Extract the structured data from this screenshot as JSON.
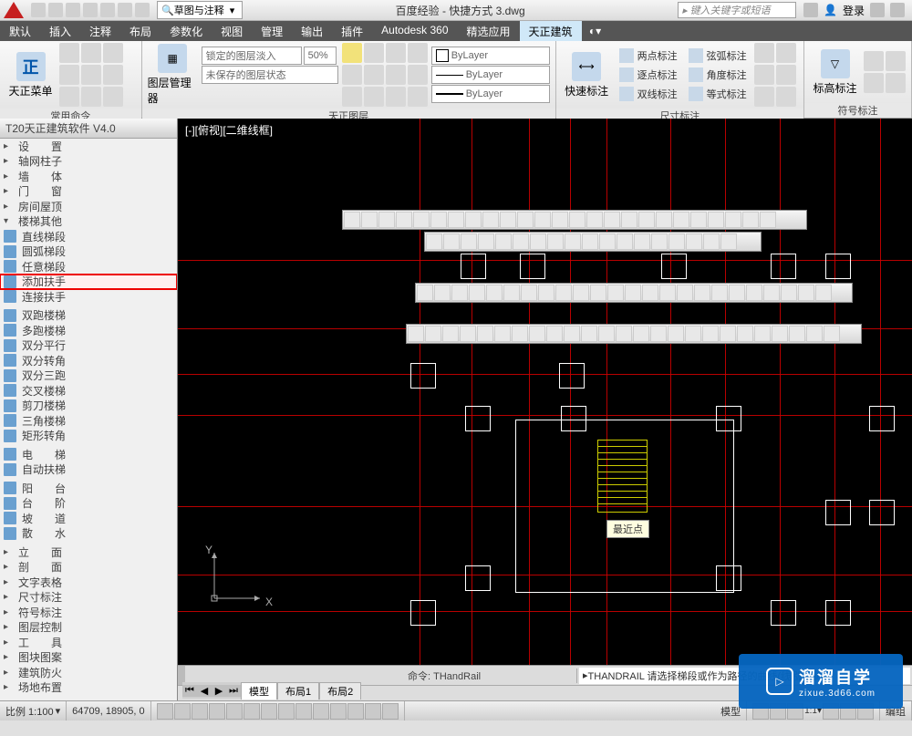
{
  "title_bar": {
    "app_title": "百度经验 - 快捷方式 3.dwg",
    "main_dropdown": "草图与注释",
    "search_placeholder": "键入关键字或短语",
    "login_label": "登录"
  },
  "menu_tabs": [
    "默认",
    "插入",
    "注释",
    "布局",
    "参数化",
    "视图",
    "管理",
    "输出",
    "插件",
    "Autodesk 360",
    "精选应用",
    "天正建筑"
  ],
  "menu_active_index": 11,
  "ribbon": {
    "groups": [
      {
        "label": "常用命令",
        "big": {
          "text": "天正菜单"
        }
      },
      {
        "label": "天正图层",
        "big": {
          "text": "图层管理器"
        },
        "combos": [
          {
            "text": "锁定的图层淡入",
            "val": "50%"
          },
          {
            "text": "未保存的图层状态"
          }
        ],
        "layer_rows": [
          {
            "text": "ByLayer"
          },
          {
            "text": "ByLayer"
          },
          {
            "text": "ByLayer"
          }
        ]
      },
      {
        "label": "尺寸标注",
        "big": {
          "text": "快速标注"
        },
        "lbls": [
          "两点标注",
          "逐点标注",
          "双线标注",
          "弦弧标注",
          "角度标注",
          "等式标注"
        ]
      },
      {
        "label": "符号标注",
        "big": {
          "text": "标高标注"
        }
      }
    ]
  },
  "left_panel": {
    "title": "T20天正建筑软件 V4.0",
    "top_items": [
      "设　　置",
      "轴网柱子",
      "墙　　体",
      "门　　窗",
      "房间屋顶",
      "楼梯其他"
    ],
    "stair_items": [
      "直线梯段",
      "圆弧梯段",
      "任意梯段",
      "添加扶手",
      "连接扶手",
      "双跑楼梯",
      "多跑楼梯",
      "双分平行",
      "双分转角",
      "双分三跑",
      "交叉楼梯",
      "剪刀楼梯",
      "三角楼梯",
      "矩形转角",
      "电　　梯",
      "自动扶梯",
      "阳　　台",
      "台　　阶",
      "坡　　道",
      "散　　水",
      "立　　面",
      "剖　　面",
      "文字表格",
      "尺寸标注",
      "符号标注",
      "图层控制",
      "工　　具",
      "图块图案",
      "建筑防火",
      "场地布置"
    ],
    "highlighted_index": 3
  },
  "canvas": {
    "view_label": "[-][俯视][二维线框]",
    "tooltip": "最近点",
    "ucs_x": "X",
    "ucs_y": "Y"
  },
  "sheet_tabs": [
    "模型",
    "布局1",
    "布局2"
  ],
  "sheet_active": 0,
  "command": {
    "history": "命令: THandRail",
    "prompt": "THANDRAIL 请选择梯段或作为路径的曲线(线/弧/圆/多"
  },
  "status_bar": {
    "scale": "比例 1:100",
    "coords": "64709, 18905, 0",
    "right_label": "模型",
    "end_label": "编组"
  },
  "watermark": {
    "brand1": "溜溜自学",
    "brand2": "zixue.3d66.com"
  }
}
